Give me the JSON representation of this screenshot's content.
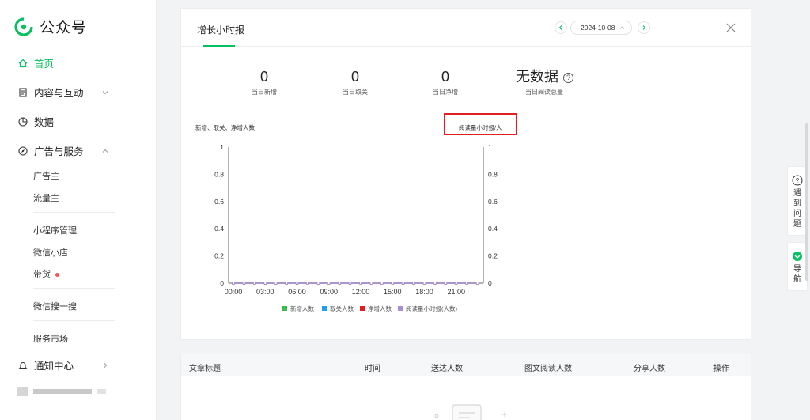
{
  "brand": {
    "name": "公众号",
    "color": "#07c160"
  },
  "sidebar": {
    "home": {
      "label": "首页",
      "icon": "home-icon"
    },
    "content": {
      "label": "内容与互动",
      "icon": "document-icon"
    },
    "data": {
      "label": "数据",
      "icon": "pie-chart-icon"
    },
    "ads": {
      "label": "广告与服务",
      "icon": "compass-icon"
    },
    "sub_items": {
      "advertiser": "广告主",
      "publisher": "流量主",
      "miniprogram": "小程序管理",
      "shop": "微信小店",
      "goods": "带货",
      "search": "微信搜一搜",
      "market": "服务市场"
    },
    "notifications": {
      "label": "通知中心",
      "icon": "bell-icon"
    }
  },
  "report": {
    "title": "增长小时报",
    "date": "2024-10-08",
    "stats": [
      {
        "value": "0",
        "label": "当日新增"
      },
      {
        "value": "0",
        "label": "当日取关"
      },
      {
        "value": "0",
        "label": "当日净增"
      },
      {
        "value": "无数据",
        "label": "当日阅读总量"
      }
    ]
  },
  "chart_data": {
    "type": "line",
    "left_axis_label": "新增、取关、净增人数",
    "right_axis_label": "阅读量小时报/人",
    "x": [
      "00:00",
      "01:00",
      "02:00",
      "03:00",
      "04:00",
      "05:00",
      "06:00",
      "07:00",
      "08:00",
      "09:00",
      "10:00",
      "11:00",
      "12:00",
      "13:00",
      "14:00",
      "15:00",
      "16:00",
      "17:00",
      "18:00",
      "19:00",
      "20:00",
      "21:00",
      "22:00",
      "23:00"
    ],
    "x_tick_labels": [
      "00:00",
      "03:00",
      "06:00",
      "09:00",
      "12:00",
      "15:00",
      "18:00",
      "21:00"
    ],
    "y_tick_labels": [
      "0",
      "0.2",
      "0.4",
      "0.6",
      "0.8",
      "1"
    ],
    "ylim": [
      0,
      1
    ],
    "series": [
      {
        "name": "新增人数",
        "color": "#3fb950",
        "values": [
          0,
          0,
          0,
          0,
          0,
          0,
          0,
          0,
          0,
          0,
          0,
          0,
          0,
          0,
          0,
          0,
          0,
          0,
          0,
          0,
          0,
          0,
          0,
          0
        ]
      },
      {
        "name": "取关人数",
        "color": "#1e9fff",
        "values": [
          0,
          0,
          0,
          0,
          0,
          0,
          0,
          0,
          0,
          0,
          0,
          0,
          0,
          0,
          0,
          0,
          0,
          0,
          0,
          0,
          0,
          0,
          0,
          0
        ]
      },
      {
        "name": "净增人数",
        "color": "#e02020",
        "values": [
          0,
          0,
          0,
          0,
          0,
          0,
          0,
          0,
          0,
          0,
          0,
          0,
          0,
          0,
          0,
          0,
          0,
          0,
          0,
          0,
          0,
          0,
          0,
          0
        ]
      },
      {
        "name": "阅读量小时报(人数)",
        "color": "#a58ed6",
        "values": [
          0,
          0,
          0,
          0,
          0,
          0,
          0,
          0,
          0,
          0,
          0,
          0,
          0,
          0,
          0,
          0,
          0,
          0,
          0,
          0,
          0,
          0,
          0,
          0
        ]
      }
    ]
  },
  "table": {
    "headers": [
      "文章标题",
      "时间",
      "送达人数",
      "图文阅读人数",
      "分享人数",
      "操作"
    ]
  },
  "tools": {
    "help": {
      "label": "遇到问题",
      "chars": [
        "遇",
        "到",
        "问",
        "题"
      ]
    },
    "nav": {
      "label": "导航",
      "chars": [
        "导",
        "航"
      ]
    }
  }
}
